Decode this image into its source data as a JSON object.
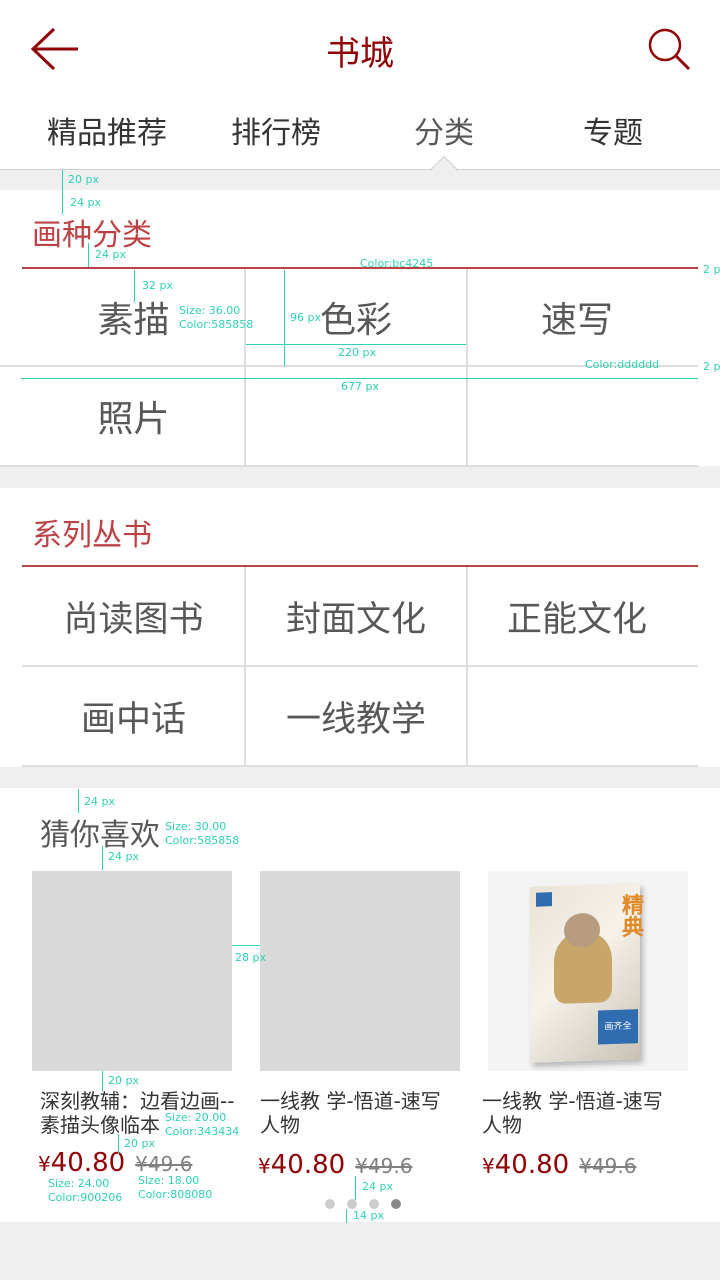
{
  "header": {
    "title": "书城",
    "back_icon": "arrow-left-icon",
    "search_icon": "search-icon"
  },
  "tabs": [
    {
      "label": "精品推荐"
    },
    {
      "label": "排行榜"
    },
    {
      "label": "分类"
    },
    {
      "label": "专题"
    }
  ],
  "genre": {
    "title": "画种分类",
    "items": [
      "素描",
      "色彩",
      "速写",
      "照片"
    ]
  },
  "series": {
    "title": "系列丛书",
    "items": [
      "尚读图书",
      "封面文化",
      "正能文化",
      "画中话",
      "一线教学"
    ]
  },
  "guess": {
    "title": "猜你喜欢",
    "books": [
      {
        "title": "深刻教辅：边看边画--素描头像临本",
        "currency": "¥",
        "price": "40.80",
        "old_price": "¥49.6"
      },
      {
        "title": "一线教 学-悟道-速写人物",
        "currency": "¥",
        "price": "40.80",
        "old_price": "¥49.6"
      },
      {
        "title": "一线教 学-悟道-速写人物",
        "currency": "¥",
        "price": "40.80",
        "old_price": "¥49.6"
      }
    ],
    "cover_text": {
      "big": "精典",
      "small": "画齐全"
    },
    "page_count": 4,
    "active_page": 4
  },
  "annotations": {
    "a20": "20 px",
    "a24": "24 px",
    "a24b": "24 px",
    "colorRed": "Color:bc4245",
    "r2a": "2 px",
    "a32": "32 px",
    "sizeCell": "Size: 36.00",
    "colorCell": "Color:585858",
    "a96": "96 px",
    "a220": "220 px",
    "colorGray": "Color:dddddd",
    "r2b": "2 px",
    "a677": "677 px",
    "g24": "24 px",
    "gSize": "Size: 30.00",
    "gColor": "Color:585858",
    "g24b": "24 px",
    "a28": "28 px",
    "a20b": "20 px",
    "tSize": "Size: 20.00",
    "tColor": "Color:343434",
    "a20c": "20 px",
    "pSize": "Size: 24.00",
    "pColor": "Color:900206",
    "oSize": "Size: 18.00",
    "oColor": "Color:808080",
    "d24": "24 px",
    "d14": "14 px"
  },
  "colors": {
    "brand": "#900206",
    "accent_line": "#bc4245",
    "divider": "#dddddd",
    "text": "#585858"
  }
}
